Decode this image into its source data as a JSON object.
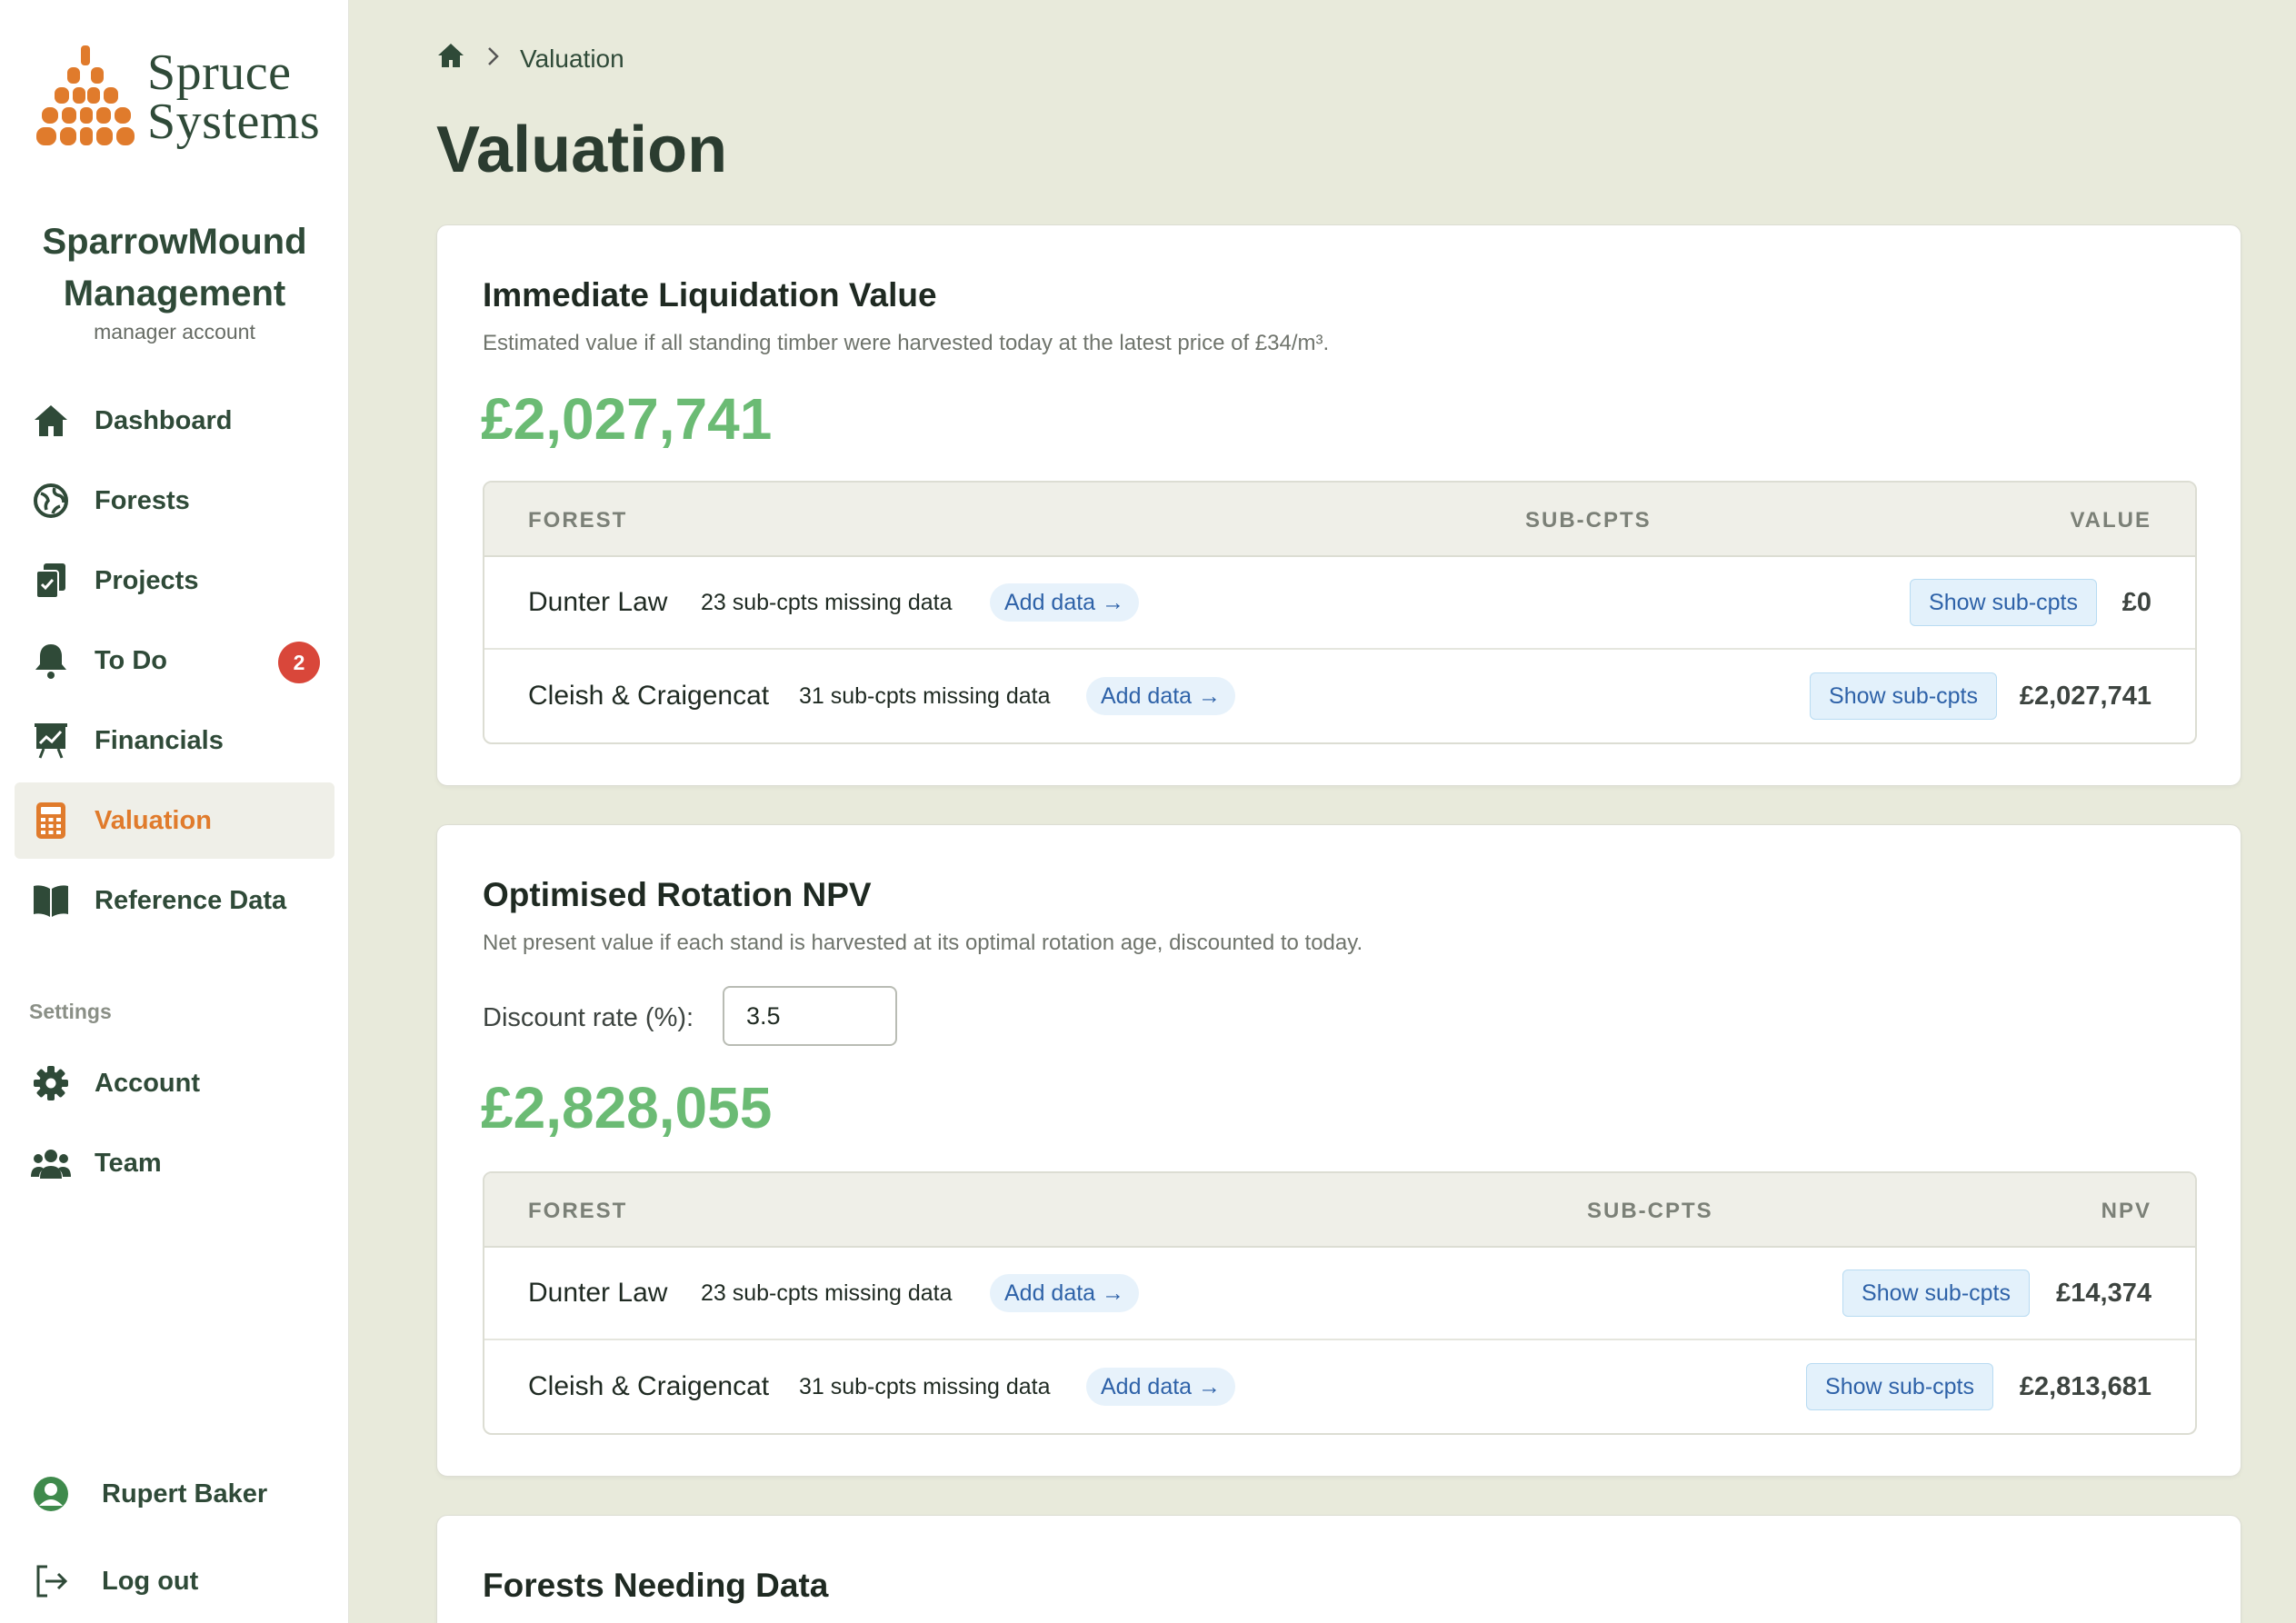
{
  "brand": {
    "line1": "Spruce",
    "line2": "Systems",
    "accent": "#e07b2c",
    "primary": "#2f4a38"
  },
  "org": {
    "name_line1": "SparrowMound",
    "name_line2": "Management",
    "role": "manager account"
  },
  "nav": [
    {
      "label": "Dashboard",
      "icon": "home-icon"
    },
    {
      "label": "Forests",
      "icon": "globe-icon"
    },
    {
      "label": "Projects",
      "icon": "clipboard-check-icon"
    },
    {
      "label": "To Do",
      "icon": "bell-icon",
      "badge": "2"
    },
    {
      "label": "Financials",
      "icon": "chart-board-icon"
    },
    {
      "label": "Valuation",
      "icon": "calculator-icon",
      "active": true
    },
    {
      "label": "Reference Data",
      "icon": "book-icon"
    }
  ],
  "settings": {
    "label": "Settings",
    "items": [
      {
        "label": "Account",
        "icon": "gear-icon"
      },
      {
        "label": "Team",
        "icon": "team-icon"
      }
    ]
  },
  "user": {
    "name": "Rupert Baker",
    "logout": "Log out"
  },
  "breadcrumb": {
    "current": "Valuation"
  },
  "page_title": "Valuation",
  "liquidation": {
    "title": "Immediate Liquidation Value",
    "description": "Estimated value if all standing timber were harvested today at the latest price of £34/m³.",
    "total": "£2,027,741",
    "columns": [
      "FOREST",
      "SUB-CPTS",
      "VALUE"
    ],
    "rows": [
      {
        "forest": "Dunter Law",
        "missing": "23 sub-cpts missing data",
        "add": "Add data →",
        "show": "Show sub-cpts",
        "value": "£0"
      },
      {
        "forest": "Cleish & Craigencat",
        "missing": "31 sub-cpts missing data",
        "add": "Add data →",
        "show": "Show sub-cpts",
        "value": "£2,027,741"
      }
    ]
  },
  "npv": {
    "title": "Optimised Rotation NPV",
    "description": "Net present value if each stand is harvested at its optimal rotation age, discounted to today.",
    "discount_label": "Discount rate (%):",
    "discount_value": "3.5",
    "total": "£2,828,055",
    "columns": [
      "FOREST",
      "SUB-CPTS",
      "NPV"
    ],
    "rows": [
      {
        "forest": "Dunter Law",
        "missing": "23 sub-cpts missing data",
        "add": "Add data →",
        "show": "Show sub-cpts",
        "value": "£14,374"
      },
      {
        "forest": "Cleish & Craigencat",
        "missing": "31 sub-cpts missing data",
        "add": "Add data →",
        "show": "Show sub-cpts",
        "value": "£2,813,681"
      }
    ]
  },
  "needing": {
    "title": "Forests Needing Data"
  }
}
